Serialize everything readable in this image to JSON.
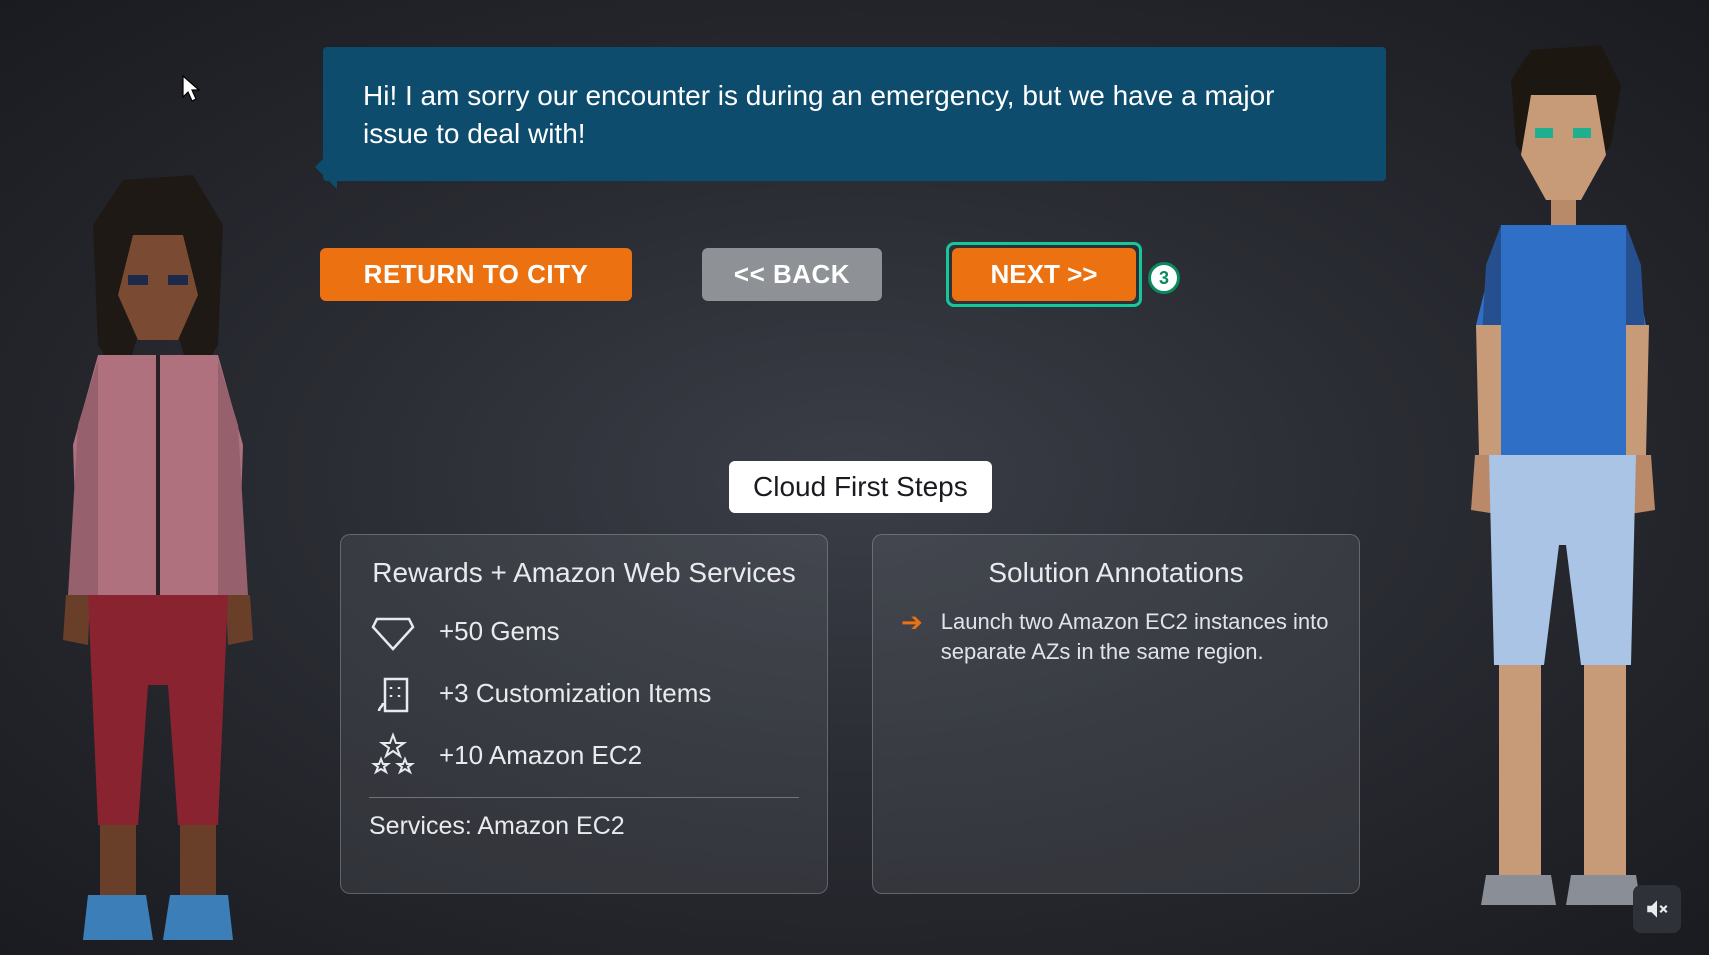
{
  "dialogue": {
    "text": "Hi! I am sorry our encounter is during an emergency, but we have a major issue to deal with!"
  },
  "buttons": {
    "return_label": "RETURN TO CITY",
    "back_label": "<< BACK",
    "next_label": "NEXT >>",
    "hint_count": "3"
  },
  "quest": {
    "title": "Cloud First Steps"
  },
  "rewards": {
    "heading": "Rewards + Amazon Web Services",
    "items": [
      {
        "icon": "gem",
        "label": "+50 Gems"
      },
      {
        "icon": "build",
        "label": "+3 Customization Items"
      },
      {
        "icon": "stars",
        "label": "+10 Amazon EC2"
      }
    ],
    "services_line": "Services: Amazon EC2"
  },
  "annotations": {
    "heading": "Solution Annotations",
    "items": [
      "Launch two Amazon EC2 instances into separate AZs in the same region."
    ]
  },
  "audio": {
    "muted": true
  }
}
